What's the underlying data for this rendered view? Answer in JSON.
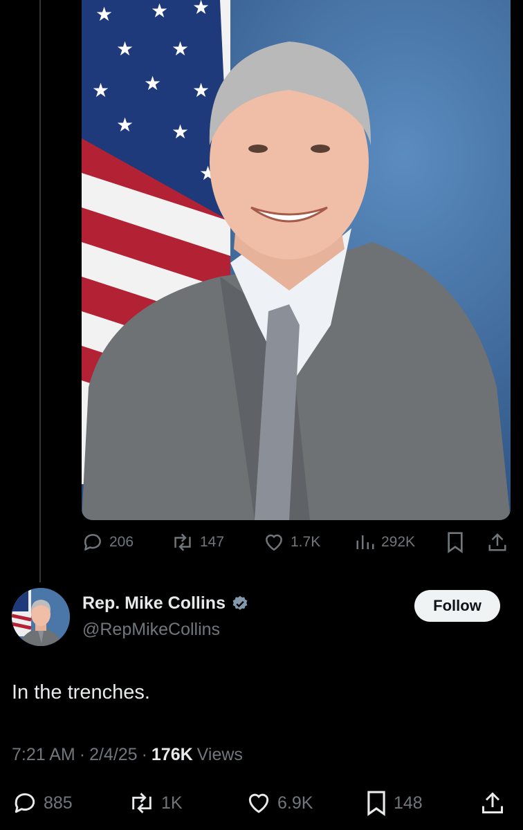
{
  "post_image": {
    "alt": "portrait"
  },
  "top_actions": {
    "replies": "206",
    "reposts": "147",
    "likes": "1.7K",
    "views": "292K"
  },
  "author": {
    "name": "Rep. Mike Collins",
    "handle": "@RepMikeCollins",
    "verified": true,
    "follow_label": "Follow"
  },
  "tweet": {
    "text": "In the trenches."
  },
  "meta": {
    "time": "7:21 AM",
    "date": "2/4/25",
    "views_count": "176K",
    "views_label": "Views",
    "separator": "·"
  },
  "bottom_actions": {
    "replies": "885",
    "reposts": "1K",
    "likes": "6.9K",
    "bookmarks": "148"
  },
  "colors": {
    "background": "#000000",
    "muted": "#71767b",
    "text": "#e7e9ea",
    "follow_bg": "#eff3f4"
  },
  "icons": [
    "reply-icon",
    "repost-icon",
    "like-icon",
    "views-icon",
    "bookmark-icon",
    "share-icon",
    "verified-badge-icon"
  ]
}
